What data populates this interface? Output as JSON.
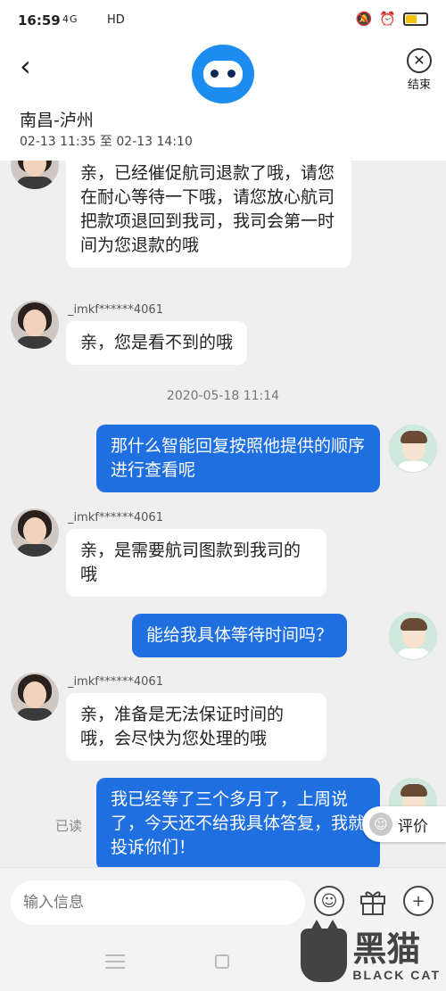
{
  "status": {
    "time": "16:59",
    "network": "4G",
    "hd": "HD"
  },
  "header": {
    "back_icon": "chevron-left-icon",
    "logo": "robot-avatar",
    "close_label": "结束",
    "route": "南昌-泸州",
    "period": "02-13 11:35 至 02-13 14:10"
  },
  "messages": [
    {
      "text": "亲，已经催促航司退款了哦，请您在耐心等待一下哦，请您放心航司把款项退回到我司，我司会第一时间为您退款的哦"
    },
    {
      "sender": "_imkf******4061",
      "text": "亲，您是看不到的哦"
    },
    {
      "timestamp": "2020-05-18 11:14"
    },
    {
      "text": "那什么智能回复按照他提供的顺序进行查看呢"
    },
    {
      "sender": "_imkf******4061",
      "text": "亲，是需要航司图款到我司的哦"
    },
    {
      "text": "能给我具体等待时间吗？"
    },
    {
      "sender": "_imkf******4061",
      "text": "亲，准备是无法保证时间的哦，会尽快为您处理的哦"
    },
    {
      "text": "我已经等了三个多月了，上周说了，今天还不给我具体答复，我就投诉你们！",
      "read_label": "已读"
    }
  ],
  "rate_button": {
    "label": "评价"
  },
  "input": {
    "placeholder": "输入信息"
  },
  "watermark": {
    "cn": "黑猫",
    "en": "BLACK CAT"
  },
  "colors": {
    "accent": "#1f6fe0",
    "bg": "#efefef"
  }
}
